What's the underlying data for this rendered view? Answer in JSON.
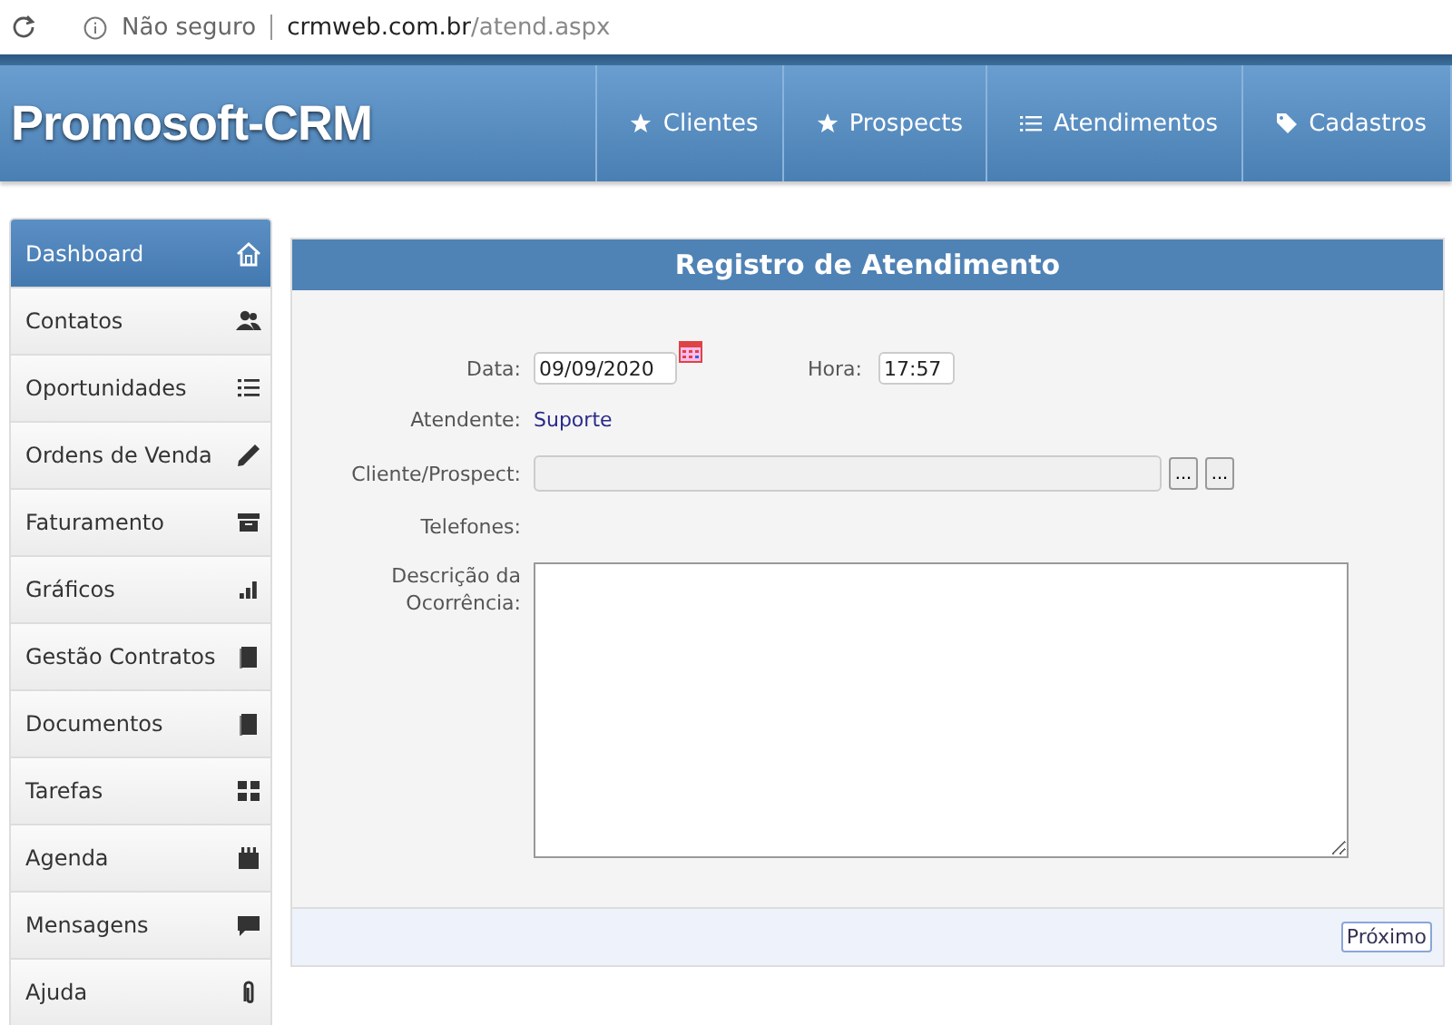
{
  "browser": {
    "security": "Não seguro",
    "url_host": "crmweb.com.br",
    "url_path": "/atend.aspx"
  },
  "header": {
    "logo": "Promosoft-CRM",
    "nav": [
      {
        "label": "Clientes",
        "kind": "star"
      },
      {
        "label": "Prospects",
        "kind": "star"
      },
      {
        "label": "Atendimentos",
        "kind": "list"
      },
      {
        "label": "Cadastros",
        "kind": "tag"
      }
    ]
  },
  "sidebar": {
    "items": [
      {
        "label": "Dashboard",
        "kind": "home",
        "selected": true
      },
      {
        "label": "Contatos",
        "kind": "users",
        "selected": false
      },
      {
        "label": "Oportunidades",
        "kind": "list",
        "selected": false
      },
      {
        "label": "Ordens de Venda",
        "kind": "pencil",
        "selected": false
      },
      {
        "label": "Faturamento",
        "kind": "archive",
        "selected": false
      },
      {
        "label": "Gráficos",
        "kind": "bars",
        "selected": false
      },
      {
        "label": "Gestão Contratos",
        "kind": "book",
        "selected": false
      },
      {
        "label": "Documentos",
        "kind": "book",
        "selected": false
      },
      {
        "label": "Tarefas",
        "kind": "grid",
        "selected": false
      },
      {
        "label": "Agenda",
        "kind": "calendar",
        "selected": false
      },
      {
        "label": "Mensagens",
        "kind": "comment",
        "selected": false
      },
      {
        "label": "Ajuda",
        "kind": "clip",
        "selected": false
      }
    ]
  },
  "form": {
    "title": "Registro de Atendimento",
    "date_label": "Data:",
    "date_value": "09/09/2020",
    "time_label": "Hora:",
    "time_value": "17:57",
    "agent_label": "Atendente:",
    "agent_value": "Suporte",
    "client_label": "Cliente/Prospect:",
    "client_buttons": [
      "...",
      "..."
    ],
    "phones_label": "Telefones:",
    "description_label": "Descrição da Ocorrência:",
    "next_button": "Próximo"
  }
}
